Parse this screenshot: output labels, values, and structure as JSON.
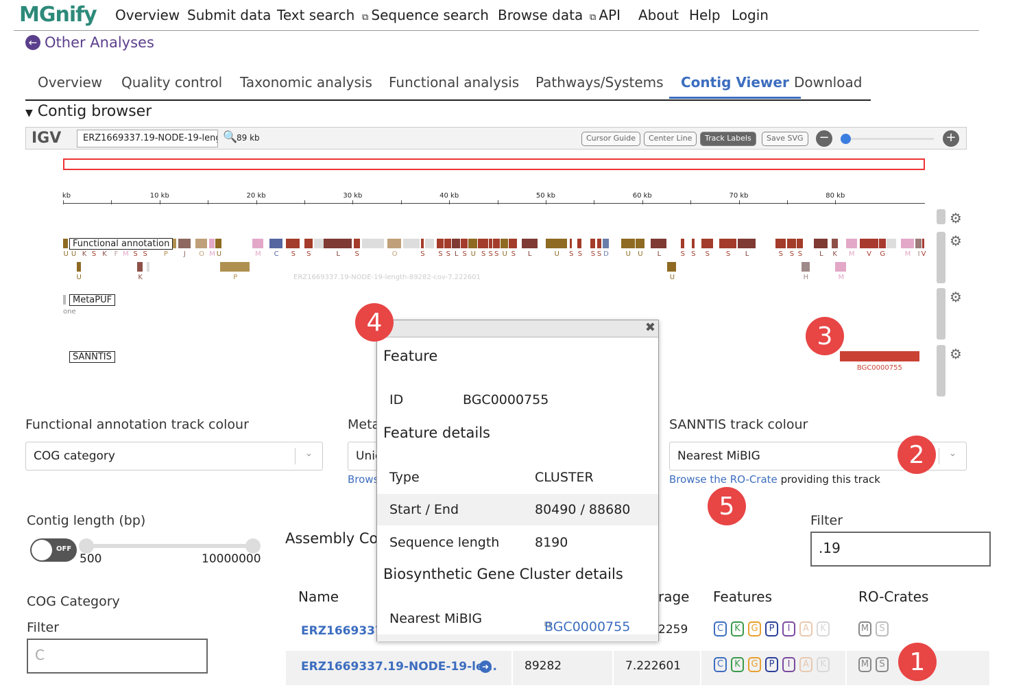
{
  "nav": {
    "logo": "MGnify",
    "items": [
      "Overview",
      "Submit data",
      "Text search",
      "Sequence search",
      "Browse data",
      "API",
      "About",
      "Help",
      "Login"
    ],
    "external": [
      false,
      false,
      false,
      true,
      false,
      true,
      false,
      false,
      false
    ]
  },
  "back_link": "Other Analyses",
  "tabs": [
    "Overview",
    "Quality control",
    "Taxonomic analysis",
    "Functional analysis",
    "Pathways/Systems",
    "Contig Viewer",
    "Download"
  ],
  "active_tab": "Contig Viewer",
  "section_title": "Contig browser",
  "igv": {
    "logo": "IGV",
    "locus": "ERZ1669337.19-NODE-19-length-89282-cov-7.222601",
    "locus_visible": "ERZ1669337.19-NODE-19-lengt",
    "width": "89 kb",
    "buttons": [
      "Cursor Guide",
      "Center Line",
      "Track Labels",
      "Save SVG"
    ],
    "active_button": "Track Labels",
    "zoom_level": 0.03
  },
  "ruler": {
    "ticks": [
      "kb",
      "10 kb",
      "20 kb",
      "30 kb",
      "40 kb",
      "50 kb",
      "60 kb",
      "70 kb",
      "80 kb"
    ],
    "length_kb": 89.282
  },
  "tracks": {
    "functional": "Functional annotation",
    "metapuf": "MetaPUF",
    "metapuf_sub": "one",
    "sanntis": "SANNTIS",
    "contig_name": "ERZ1669337.19-NODE-19-length-89282-cov-7.222601",
    "sanntis_feature": {
      "label": "BGC0000755",
      "start_kb": 80.49,
      "end_kb": 88.68,
      "color": "#c94233"
    }
  },
  "cog_colors": {
    "S": "#a33c2a",
    "L": "#7e3a33",
    "U": "#8e6a22",
    "K": "#8d5149",
    "M": "#e3a8c8",
    "C": "#5566a0",
    "P": "#b09050",
    "J": "#8d6860",
    "O": "#c0a07a",
    "D": "#6a7eaa",
    "H": "#9e8a88",
    "I": "#9c7b7b",
    "V": "#a8392f",
    "G": "#a8392f",
    "F": "#b8a0a0",
    "-": "#dddddd"
  },
  "features": [
    [
      0,
      0.6,
      "U",
      1
    ],
    [
      0.8,
      1.4,
      "U",
      1
    ],
    [
      1.9,
      2.5,
      "K",
      1
    ],
    [
      2.9,
      3.5,
      "S",
      1
    ],
    [
      4.0,
      4.6,
      "K",
      1
    ],
    [
      5.2,
      5.8,
      "F",
      1
    ],
    [
      6.2,
      6.8,
      "M",
      1
    ],
    [
      7.2,
      7.8,
      "S",
      1
    ],
    [
      8.2,
      8.8,
      "S",
      1
    ],
    [
      9.5,
      11.8,
      "P",
      1
    ],
    [
      11.9,
      13.3,
      "J",
      1
    ],
    [
      13.7,
      15.0,
      "O",
      1
    ],
    [
      15.1,
      15.8,
      "M",
      1
    ],
    [
      15.8,
      16.5,
      "U",
      1
    ],
    [
      19.6,
      20.8,
      "M",
      1
    ],
    [
      21.4,
      22.8,
      "C",
      1
    ],
    [
      23.1,
      24.6,
      "S",
      1
    ],
    [
      25.0,
      25.9,
      "S",
      1
    ],
    [
      26.0,
      28.0,
      "-",
      1
    ],
    [
      27.0,
      30.0,
      "L",
      1
    ],
    [
      30.1,
      30.8,
      "S",
      1
    ],
    [
      31.0,
      33.3,
      "-",
      1
    ],
    [
      33.6,
      35.1,
      "O",
      1
    ],
    [
      35.2,
      37.0,
      "-",
      1
    ],
    [
      37.1,
      37.4,
      "S",
      1
    ],
    [
      37.5,
      38.5,
      "-",
      1
    ],
    [
      38.7,
      39.5,
      "S",
      1
    ],
    [
      39.5,
      40.3,
      "S",
      1
    ],
    [
      40.3,
      41.2,
      "L",
      1
    ],
    [
      41.2,
      42.0,
      "S",
      1
    ],
    [
      42.0,
      43.0,
      "U",
      1
    ],
    [
      43.0,
      44.1,
      "S",
      1
    ],
    [
      44.1,
      44.5,
      "S",
      1
    ],
    [
      44.5,
      45.3,
      "S",
      1
    ],
    [
      45.3,
      46.2,
      "U",
      1
    ],
    [
      46.2,
      47.1,
      "S",
      1
    ],
    [
      47.5,
      49.2,
      "L",
      1
    ],
    [
      50.0,
      52.3,
      "U",
      1
    ],
    [
      52.5,
      52.8,
      "S",
      1
    ],
    [
      53.3,
      53.8,
      "S",
      1
    ],
    [
      54.6,
      55.2,
      "S",
      1
    ],
    [
      55.3,
      55.8,
      "S",
      1
    ],
    [
      55.9,
      56.6,
      "D",
      1
    ],
    [
      57.8,
      59.3,
      "U",
      1
    ],
    [
      59.3,
      60.3,
      "U",
      1
    ],
    [
      60.9,
      62.6,
      "L",
      1
    ],
    [
      64.0,
      64.4,
      "S",
      1
    ],
    [
      65.1,
      65.5,
      "S",
      1
    ],
    [
      66.1,
      67.4,
      "S",
      1
    ],
    [
      68.0,
      69.8,
      "S",
      1
    ],
    [
      69.9,
      71.8,
      "L",
      1
    ],
    [
      73.8,
      74.9,
      "S",
      1
    ],
    [
      75.0,
      76.0,
      "S",
      1
    ],
    [
      76.0,
      76.7,
      "S",
      1
    ],
    [
      77.8,
      79.3,
      "L",
      1
    ],
    [
      79.6,
      80.3,
      "K",
      1
    ],
    [
      81.1,
      82.3,
      "M",
      1
    ],
    [
      82.5,
      84.5,
      "V",
      1
    ],
    [
      84.5,
      85.3,
      "G",
      1
    ],
    [
      85.3,
      86.4,
      "-",
      1
    ],
    [
      86.8,
      88.2,
      "M",
      1
    ],
    [
      88.3,
      89.0,
      "I",
      1
    ],
    [
      89.0,
      89.28,
      "V",
      1
    ],
    [
      1.4,
      1.9,
      "U",
      2
    ],
    [
      7.7,
      8.3,
      "K",
      2
    ],
    [
      8.7,
      9.0,
      "-",
      2
    ],
    [
      16.3,
      19.4,
      "P",
      2
    ],
    [
      62.6,
      63.6,
      "U",
      2
    ],
    [
      76.5,
      77.4,
      "H",
      2
    ],
    [
      80.0,
      81.2,
      "M",
      2
    ]
  ],
  "controls": {
    "functional_colour_label": "Functional annotation track colour",
    "functional_colour_value": "COG category",
    "metapuf_label": "Meta",
    "metapuf_value": "Unic",
    "metapuf_link": "Brows",
    "sanntis_label": "SANNTIS track colour",
    "sanntis_value": "Nearest MiBIG",
    "sanntis_link": "Browse the RO-Crate",
    "sanntis_link_suffix": "providing this track"
  },
  "popup": {
    "feature_title": "Feature",
    "id_label": "ID",
    "id_value": "BGC0000755",
    "details_title": "Feature details",
    "type_label": "Type",
    "type_value": "CLUSTER",
    "startend_label": "Start / End",
    "startend_value": "80490 / 88680",
    "seqlen_label": "Sequence length",
    "seqlen_value": "8190",
    "bgc_title": "Biosynthetic Gene Cluster details",
    "mibig_label": "Nearest MiBIG",
    "mibig_value": "BGC0000755"
  },
  "filters": {
    "contig_length_label": "Contig length (bp)",
    "toggle": "OFF",
    "min": "500",
    "max": "10000000",
    "cog_label": "COG Category",
    "cog_filter_label": "Filter",
    "cog_filter_value": "C",
    "filter_label": "Filter",
    "filter_value": ".19"
  },
  "table": {
    "title": "Assembly Co",
    "headers": [
      "Name",
      "",
      "rage",
      "Features",
      "RO-Crates"
    ],
    "rows": [
      {
        "name": "ERZ1669337.",
        "length": "",
        "coverage": "2259"
      },
      {
        "name": "ERZ1669337.19-NODE-19-le...",
        "length": "89282",
        "coverage": "7.222601"
      }
    ],
    "feature_chips": [
      {
        "l": "C",
        "c": "#3c6dbf"
      },
      {
        "l": "K",
        "c": "#3a9a4a"
      },
      {
        "l": "G",
        "c": "#e8a030"
      },
      {
        "l": "P",
        "c": "#2a3f9a"
      },
      {
        "l": "I",
        "c": "#7a4aa0"
      },
      {
        "l": "A",
        "c": "#e8c8b0"
      },
      {
        "l": "K",
        "c": "#d8d8d8"
      }
    ],
    "rocrate_chips": [
      {
        "l": "M",
        "c": "#888888"
      },
      {
        "l": "S",
        "c": "#bbbbbb"
      }
    ],
    "rocrate_chips_row2": [
      {
        "l": "M",
        "c": "#888888"
      },
      {
        "l": "S",
        "c": "#888888"
      }
    ]
  },
  "annotations": [
    "1",
    "2",
    "3",
    "4",
    "5"
  ]
}
